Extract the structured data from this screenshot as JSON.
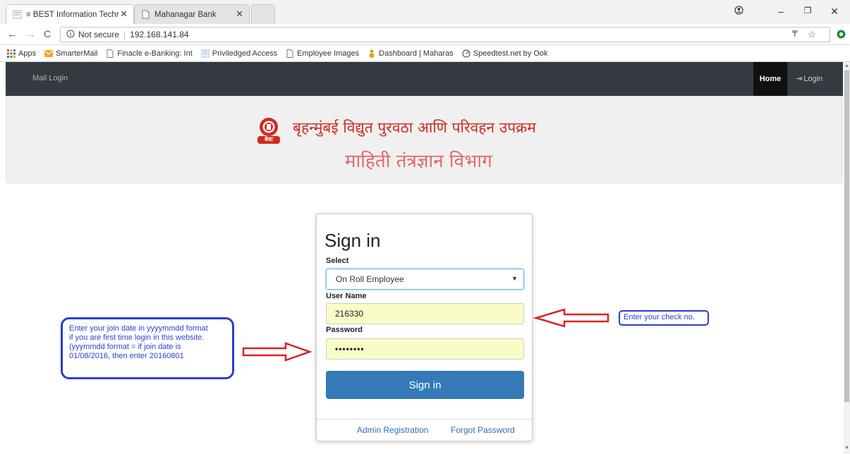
{
  "browser": {
    "tabs": [
      {
        "label": "≡ BEST Information Techr",
        "close": "✕"
      },
      {
        "label": "Mahanagar Bank",
        "close": "✕"
      }
    ],
    "url_security": "Not secure",
    "url": "192.168.141.84",
    "bookmarks": [
      {
        "label": "Apps",
        "icon": "apps-grid-icon",
        "color": "#e04a2f"
      },
      {
        "label": "SmarterMail",
        "icon": "mail-icon",
        "color": "#f2a81d"
      },
      {
        "label": "Finacle e-Banking: Int",
        "icon": "page-icon",
        "color": "#888888"
      },
      {
        "label": "Priviledged Access",
        "icon": "page-icon",
        "color": "#9db7d6"
      },
      {
        "label": "Employee Images",
        "icon": "page-icon",
        "color": "#888888"
      },
      {
        "label": "Dashboard | Maharas",
        "icon": "dashboard-icon",
        "color": "#d8a31c"
      },
      {
        "label": "Speedtest.net by Ook",
        "icon": "speedometer-icon",
        "color": "#555555"
      }
    ]
  },
  "nav": {
    "brand": "Mail Login",
    "home": "Home",
    "login": "Login"
  },
  "banner": {
    "line1": "बृहन्मुंबई विद्युत पुरवठा आणि परिवहन उपक्रम",
    "line2": "माहिती तंत्रज्ञान विभाग",
    "logo_text": "बेस्ट"
  },
  "form": {
    "title": "Sign in",
    "select_label": "Select",
    "select_value": "On Roll Employee",
    "username_label": "User Name",
    "username_value": "216330",
    "password_label": "Password",
    "password_value": "••••••••",
    "submit": "Sign in",
    "admin_link": "Admin Registration",
    "forgot_link": "Forgot Password"
  },
  "annotations": {
    "left_note": [
      "Enter your join date in yyyymmdd format",
      "if you are first time login in this website.",
      "(yyymmdd format = if join date is",
      "01/08/2016, then enter 20160801"
    ],
    "right_note": "Enter your check no."
  },
  "colors": {
    "navbar": "#343a40",
    "primary": "#337ab7",
    "banner_red": "#d12a1f",
    "annotation_blue": "#2e3fc7",
    "arrow_red": "#e02020"
  }
}
